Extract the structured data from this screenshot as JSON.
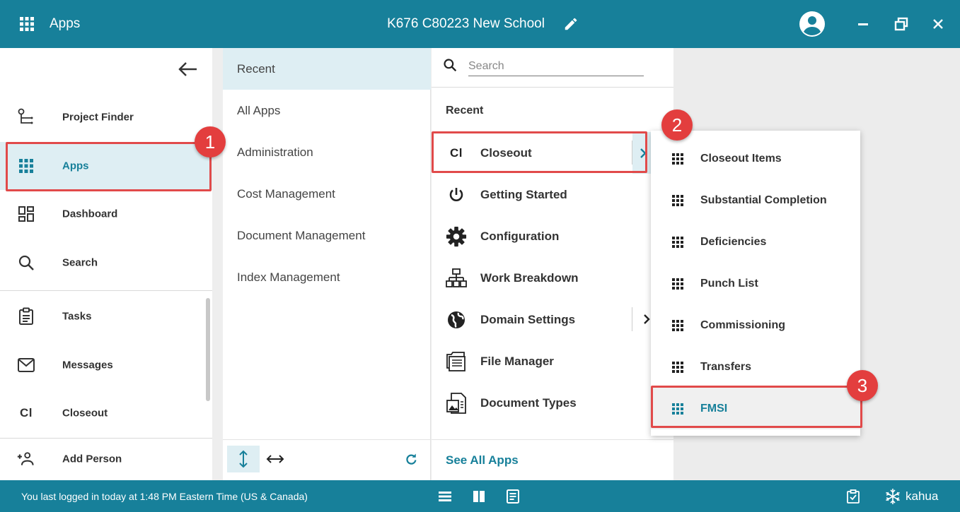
{
  "topbar": {
    "apps_label": "Apps",
    "project_title": "K676 C80223 New School"
  },
  "left_nav": {
    "items": [
      {
        "label": "Project Finder",
        "icon": "project-finder-icon"
      },
      {
        "label": "Apps",
        "icon": "apps-grid-icon"
      },
      {
        "label": "Dashboard",
        "icon": "dashboard-icon"
      },
      {
        "label": "Search",
        "icon": "search-icon"
      },
      {
        "label": "Tasks",
        "icon": "clipboard-icon"
      },
      {
        "label": "Messages",
        "icon": "mail-icon"
      },
      {
        "label": "Closeout",
        "icon": "closeout-icon",
        "icon_text": "Cl"
      },
      {
        "label": "Add Person",
        "icon": "add-person-icon"
      }
    ]
  },
  "categories": {
    "items": [
      "Recent",
      "All Apps",
      "Administration",
      "Cost Management",
      "Document Management",
      "Index Management"
    ]
  },
  "app_list": {
    "search_placeholder": "Search",
    "heading": "Recent",
    "items": [
      {
        "label": "Closeout",
        "icon": "closeout-icon",
        "icon_text": "Cl"
      },
      {
        "label": "Getting Started",
        "icon": "power-icon"
      },
      {
        "label": "Configuration",
        "icon": "gear-icon"
      },
      {
        "label": "Work Breakdown",
        "icon": "hierarchy-icon"
      },
      {
        "label": "Domain Settings",
        "icon": "globe-icon"
      },
      {
        "label": "File Manager",
        "icon": "file-manager-icon"
      },
      {
        "label": "Document Types",
        "icon": "document-types-icon"
      }
    ],
    "see_all": "See All Apps"
  },
  "submenu": {
    "items": [
      "Closeout Items",
      "Substantial Completion",
      "Deficiencies",
      "Punch List",
      "Commissioning",
      "Transfers",
      "FMSI"
    ]
  },
  "callouts": [
    "1",
    "2",
    "3"
  ],
  "statusbar": {
    "message": "You last logged in today at 1:48 PM Eastern Time (US & Canada)",
    "brand": "kahua"
  },
  "colors": {
    "primary": "#17809a",
    "highlight": "#deeef3",
    "callout": "#e33e3e"
  }
}
